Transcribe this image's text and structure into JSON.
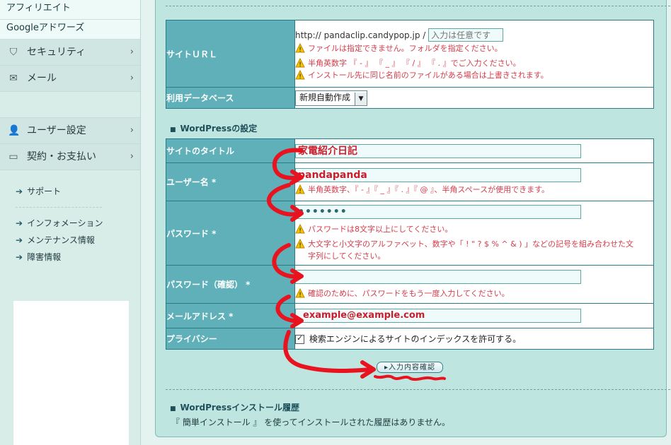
{
  "sidebar": {
    "top_items": [
      "アフィリエイト",
      "Googleアドワーズ"
    ],
    "menu": [
      {
        "label": "セキュリティ",
        "icon": "shield-icon",
        "glyph": "⛉"
      },
      {
        "label": "メール",
        "icon": "mail-icon",
        "glyph": "✉"
      },
      {
        "label": "ユーザー設定",
        "icon": "user-icon",
        "glyph": "👤"
      },
      {
        "label": "契約・お支払い",
        "icon": "credit-card-icon",
        "glyph": "▭"
      }
    ],
    "chevron": "›",
    "links_a": [
      "サポート"
    ],
    "links_b": [
      "インフォメーション",
      "メンテナンス情報",
      "障害情報"
    ],
    "arrow": "➔"
  },
  "site_url": {
    "label": "サイトＵＲＬ",
    "prefix": "http:// pandaclip.candypop.jp /",
    "placeholder": "入力は任意です",
    "warnings": [
      "ファイルは指定できません。フォルダを指定ください。",
      "半角英数字 『 - 』 『 _ 』 『 / 』 『 . 』でご入力ください。",
      "インストール先に同じ名前のファイルがある場合は上書きされます。"
    ]
  },
  "database": {
    "label": "利用データベース",
    "value": "新規自動作成"
  },
  "wp_section_title": "WordPressの設定",
  "site_title": {
    "label": "サイトのタイトル",
    "value": "家電紹介日記"
  },
  "username": {
    "label": "ユーザー名 *",
    "value": "pandapanda",
    "warning": "半角英数字、『 - 』『 _ 』『 . 』『 @ 』、半角スペースが使用できます。"
  },
  "password": {
    "label": "パスワード *",
    "value": "•••••••",
    "warnings": [
      "パスワードは8文字以上にしてください。",
      "大文字と小文字のアルファベット、数字や「 ! \" ? $ % ^ & ) 」などの記号を組み合わせた文",
      "字列にしてください。"
    ]
  },
  "password_confirm": {
    "label": "パスワード（確認） *",
    "value": "",
    "warning": "確認のために、パスワードをもう一度入力してください。"
  },
  "email": {
    "label": "メールアドレス *",
    "value": "example@example.com"
  },
  "privacy": {
    "label": "プライバシー",
    "checkbox_label": "検索エンジンによるサイトのインデックスを許可する。",
    "checked": true,
    "check": "✓"
  },
  "confirm_button": "入力内容確認",
  "history_title": "WordPressインストール履歴",
  "history_text": "『 簡単インストール 』 を使ってインストールされた履歴はありません。",
  "colors": {
    "accent": "#5fb0b9",
    "warning": "#d53c4b",
    "annotation": "#e8131f"
  }
}
